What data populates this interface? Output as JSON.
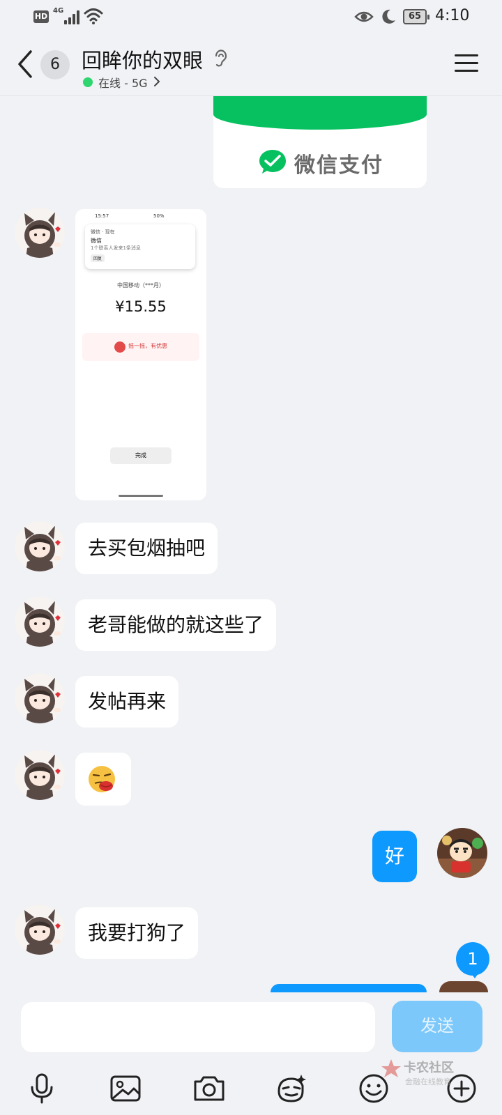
{
  "status_bar": {
    "hd": "HD",
    "network": "4G",
    "battery": "65",
    "time": "4:10"
  },
  "header": {
    "unread_count": "6",
    "title": "回眸你的双眼",
    "online_status": "在线 - 5G"
  },
  "messages": {
    "payment_card_label": "微信支付",
    "screenshot": {
      "status_time": "15:57",
      "status_right": "50%",
      "notif_source": "微信 · 现在",
      "notif_title": "微信",
      "notif_body": "1个联系人发来1条消息",
      "notif_action": "回复",
      "merchant": "中国移动（***月）",
      "amount": "¥15.55",
      "promo": "摇一摇，有优惠",
      "done": "完成"
    },
    "m1": "去买包烟抽吧",
    "m2": "老哥能做的就这些了",
    "m3": "发帖再来",
    "m4_sticker": "tongue-out-emoji",
    "m5_me": "好",
    "m6": "我要打狗了",
    "new_message_badge": "1"
  },
  "input_bar": {
    "placeholder": "",
    "send_label": "发送"
  },
  "watermark": {
    "main": "卡农社区",
    "sub": "金融在线教育"
  },
  "icons": {
    "back": "chevron-left-icon",
    "ear": "ear-icon",
    "menu": "hamburger-menu-icon",
    "voice": "microphone-icon",
    "image": "image-icon",
    "camera": "camera-icon",
    "sticker": "sticker-icon",
    "emoji": "smile-icon",
    "plus": "plus-circle-icon"
  },
  "colors": {
    "accent": "#0e99ff",
    "online": "#2fd670",
    "wechat_green": "#07c160",
    "send_disabled": "#7cc8fb"
  }
}
